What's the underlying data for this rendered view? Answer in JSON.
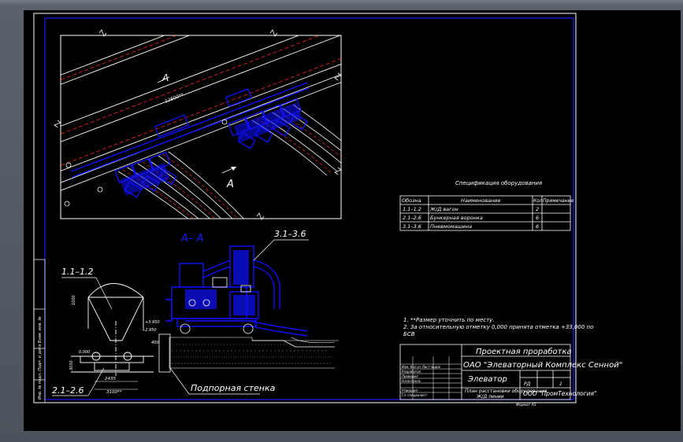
{
  "colors": {
    "background": "#000000",
    "border": "#1a1aff",
    "line": "#ffffff",
    "equipment": "#1010ff",
    "rail": "#ff2020",
    "frame": "#5f6670"
  },
  "spec": {
    "title": "Спецификация оборудования",
    "headers": [
      "Обозна",
      "Наименование",
      "Кол",
      "Примечание"
    ],
    "rows": [
      {
        "code": "1.1–1.2",
        "name": "Ж/Д вагон",
        "qty": "2",
        "note": ""
      },
      {
        "code": "2.1–2.6",
        "name": "Бункерная воронка",
        "qty": "6",
        "note": ""
      },
      {
        "code": "3.1–3.6",
        "name": "Пневмомашина",
        "qty": "6",
        "note": ""
      }
    ]
  },
  "notes": {
    "line1": "1. **Размер уточнить по месту.",
    "line2": "2. За относительную отметку 0,000 принята отметка +33,000 по",
    "line3": "БСВ"
  },
  "labels": {
    "section_title": "А– А",
    "section_marker": "А",
    "label_1": "1.1–1.2",
    "label_2": "2.1–2.6",
    "label_3": "3.1–3.6",
    "wall_caption": "Подпорная стенка",
    "dim_top": "12800**",
    "elev_a": "+3.950",
    "elev_b": "+2.950",
    "elev_c": "0.000",
    "dim_a": "2435",
    "dim_b": "3100**",
    "dim_side": "3050",
    "dim_small": "400",
    "dim_small2": "1000"
  },
  "title_block": {
    "line1": "Проектная проработка",
    "line2": "ОАО \"Элеваторный Комплекс Сенной\"",
    "line3": "Элеватор",
    "stage": "РД",
    "sheet": "1",
    "drawing_name": "План расстановки оборудования",
    "drawing_name2": "Ж/Д линии",
    "company": "ООО \"ПромТехнология\"",
    "format": "Формат А3",
    "left_cells": [
      "Изм. Кол.уч Лист №док",
      "Разработал",
      "Проверил",
      "Н.контроль",
      "Утвердил",
      "Гл. специалист"
    ],
    "side_strip": "Инв. № подл. Подп. и дата Взам. инв. №"
  }
}
